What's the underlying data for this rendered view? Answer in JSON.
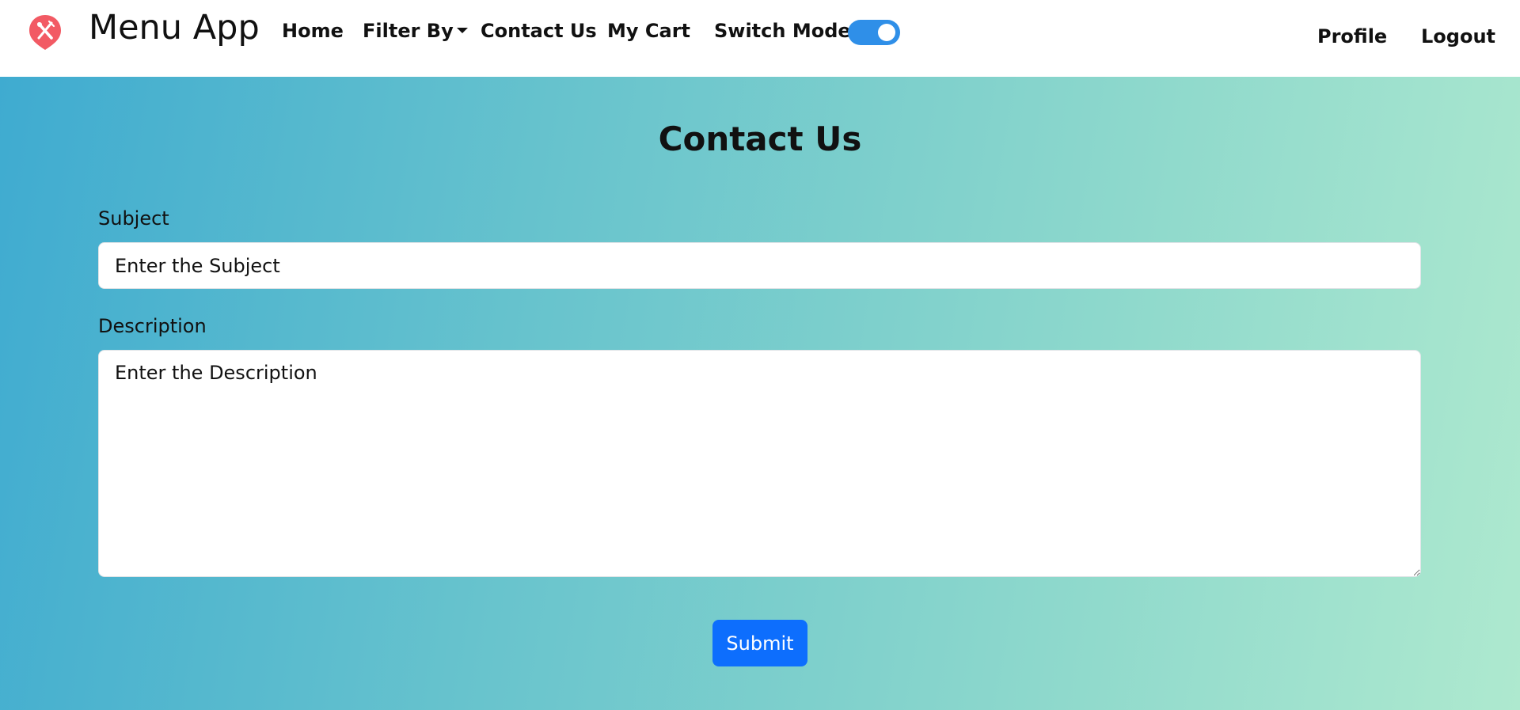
{
  "nav": {
    "brand": "Menu App",
    "logo_icon": "utensils-pin-icon",
    "links": {
      "home": "Home",
      "filter_by": "Filter By",
      "contact_us": "Contact Us",
      "my_cart": "My Cart",
      "switch_mode": "Switch Mode",
      "profile": "Profile",
      "logout": "Logout"
    },
    "switch_mode_on": true
  },
  "page": {
    "title": "Contact Us"
  },
  "form": {
    "subject_label": "Subject",
    "subject_placeholder": "Enter the Subject",
    "description_label": "Description",
    "description_placeholder": "Enter the Description",
    "submit_label": "Submit"
  },
  "colors": {
    "logo": "#f25a64",
    "toggle": "#2f8fe8",
    "submit": "#0d6efd",
    "gradient_start": "#3fabd0",
    "gradient_end": "#aee9cf"
  }
}
